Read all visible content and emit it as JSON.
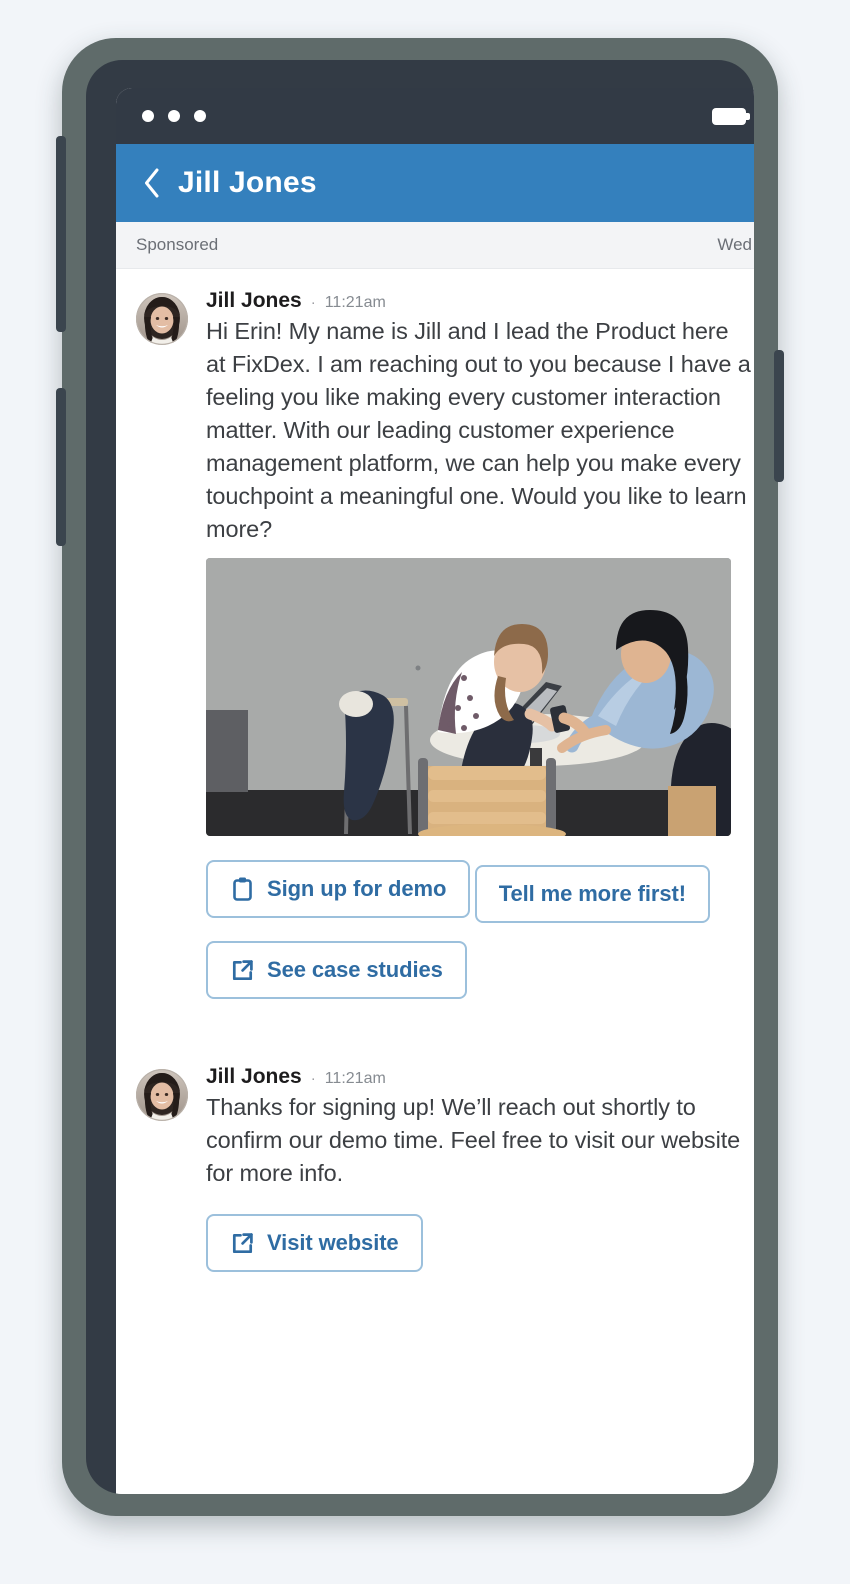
{
  "device": {
    "status_bar": {
      "dots_icon": "three-dots-icon",
      "dot_count": 3,
      "battery_icon": "battery-full-icon"
    }
  },
  "app_header": {
    "back_icon": "back-chevron-icon",
    "title": "Jill Jones",
    "background_color": "#3480bd"
  },
  "sponsored_bar": {
    "label": "Sponsored",
    "day": "Wed",
    "background_color": "#f3f4f6"
  },
  "messages": [
    {
      "author": "Jill Jones",
      "separator": "·",
      "time": "11:21am",
      "avatar_icon": "user-avatar-photo",
      "text": "Hi Erin! My name is Jill and I lead the Product here at FixDex. I am reaching out to you because I have a feeling you like making every customer interaction matter. With our leading customer experience management platform, we can help you make every touchpoint a meaningful one. Would you like to learn more?",
      "image_alt": "Two women collaborating at a cafe table with a laptop and phone",
      "actions": [
        {
          "label": "Sign up for demo",
          "icon": "clipboard-icon"
        },
        {
          "label": "Tell me more first!",
          "icon": "none"
        },
        {
          "label": "See case studies",
          "icon": "external-link-icon"
        }
      ]
    },
    {
      "author": "Jill Jones",
      "separator": "·",
      "time": "11:21am",
      "avatar_icon": "user-avatar-photo",
      "text": "Thanks for signing up! We’ll reach out shortly to confirm our demo time. Feel free to visit our website for more info.",
      "actions": [
        {
          "label": "Visit website",
          "icon": "external-link-icon"
        }
      ]
    }
  ],
  "colors": {
    "accent_blue": "#3480bd",
    "button_text": "#2f6ca3",
    "button_border": "#9cc0dc",
    "status_bar": "#323a45",
    "device_shell": "#5f6b6a",
    "page_background": "#f2f5f9"
  }
}
